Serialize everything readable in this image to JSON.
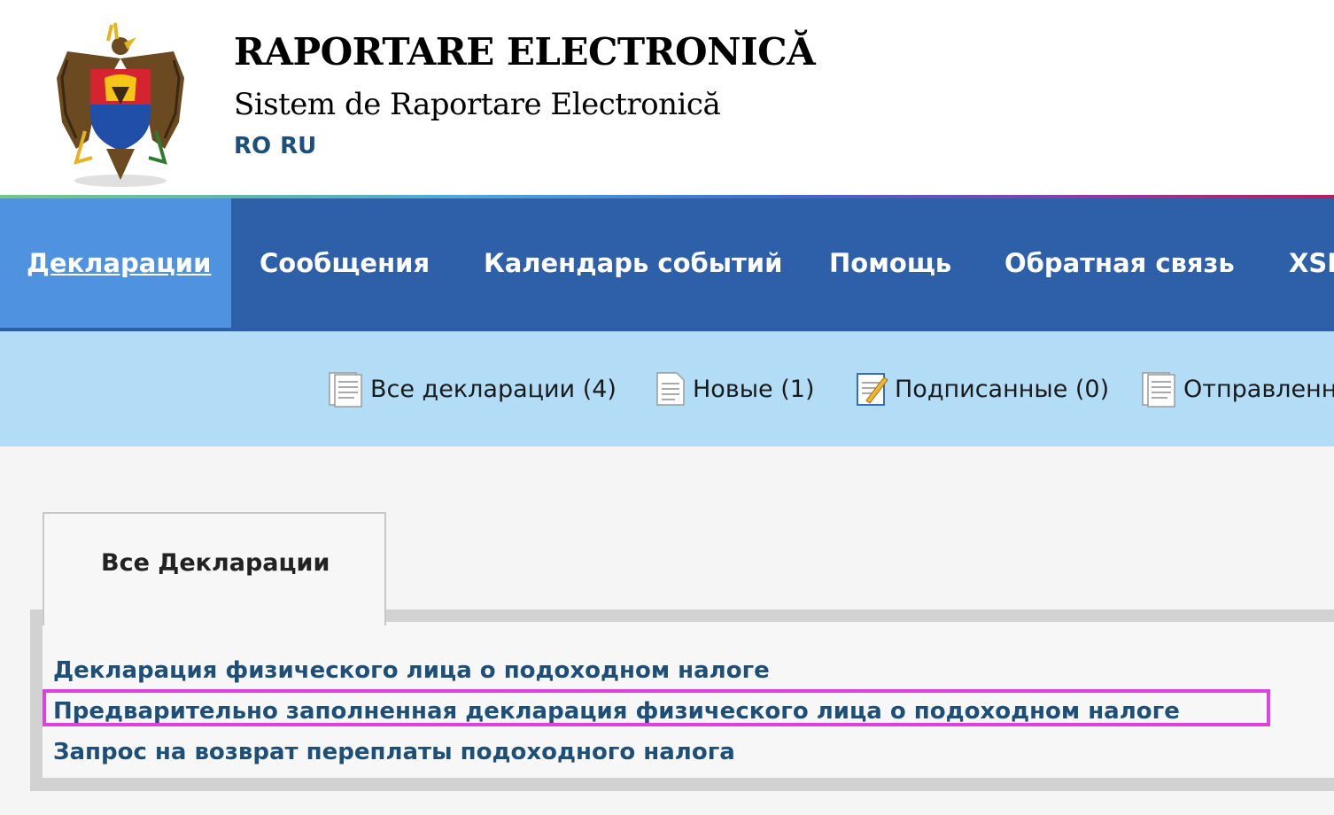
{
  "header": {
    "title": "RAPORTARE ELECTRONICĂ",
    "subtitle": "Sistem de Raportare Electronică",
    "languages": [
      "RO",
      "RU"
    ],
    "logo_icon": "moldova-coat-of-arms"
  },
  "main_nav": {
    "items": [
      {
        "label": "Декларации",
        "active": true
      },
      {
        "label": "Сообщения"
      },
      {
        "label": "Календарь событий"
      },
      {
        "label": "Помощь"
      },
      {
        "label": "Обратная связь"
      },
      {
        "label": "XSI"
      }
    ]
  },
  "sub_nav": {
    "items": [
      {
        "label": "Все декларации (4)",
        "icon": "document-list-icon"
      },
      {
        "label": "Новые (1)",
        "icon": "document-icon"
      },
      {
        "label": "Подписанные (0)",
        "icon": "signed-document-icon"
      },
      {
        "label": "Отправленн",
        "icon": "document-list-icon"
      }
    ]
  },
  "tabs": [
    {
      "label": "Все Декларации"
    }
  ],
  "declarations": [
    "Декларация физического лица о подоходном налоге",
    "Предварительно заполненная декларация физического лица о подоходном налоге",
    "Запрос на возврат переплаты подоходного налога"
  ],
  "colors": {
    "nav_bg": "#2e5fa9",
    "nav_active_bg": "#4f93e0",
    "subnav_bg": "#b3ddf7",
    "link": "#1d4f78",
    "highlight": "#e040e0"
  }
}
